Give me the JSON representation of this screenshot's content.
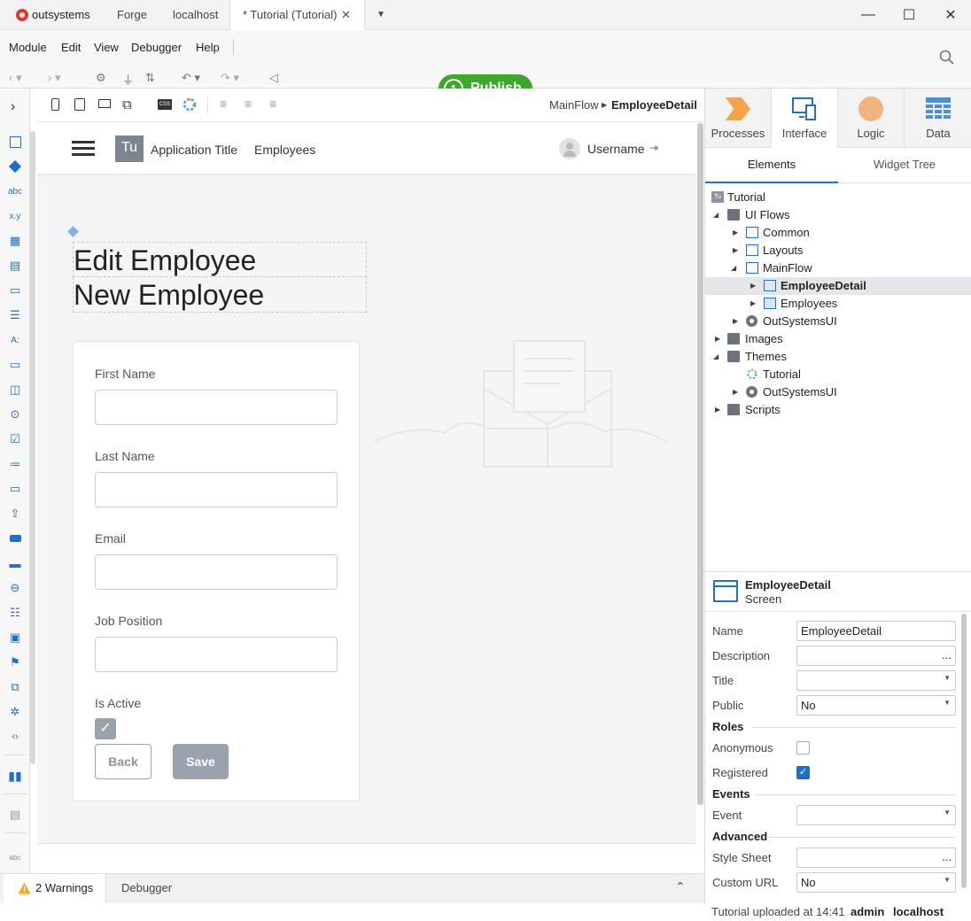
{
  "titlebar": {
    "brand": "outsystems",
    "tabs": [
      "Forge",
      "localhost",
      "* Tutorial (Tutorial)"
    ],
    "minimize": "—",
    "maximize": "☐",
    "close": "✕"
  },
  "menu": {
    "items": [
      "Module",
      "Edit",
      "View",
      "Debugger",
      "Help"
    ],
    "publish_count": "1",
    "publish_label": "Publish"
  },
  "breadcrumb": {
    "parent": "MainFlow",
    "current": "EmployeeDetail"
  },
  "canvas": {
    "logo": "Tu",
    "app_title": "Application Title",
    "menu_link": "Employees",
    "username": "Username",
    "title_edit": "Edit Employee",
    "title_new": "New Employee",
    "fields": [
      "First Name",
      "Last Name",
      "Email",
      "Job Position",
      "Is Active"
    ],
    "is_active_checked": true,
    "back_label": "Back",
    "save_label": "Save"
  },
  "bottom": {
    "warnings": "2 Warnings",
    "debugger": "Debugger"
  },
  "right_tabs": [
    "Processes",
    "Interface",
    "Logic",
    "Data"
  ],
  "subtabs": {
    "elements": "Elements",
    "widget_tree": "Widget Tree"
  },
  "tree": {
    "root": "Tutorial",
    "ui_flows": "UI Flows",
    "common": "Common",
    "layouts": "Layouts",
    "mainflow": "MainFlow",
    "employee_detail": "EmployeeDetail",
    "employees": "Employees",
    "outsystemsui": "OutSystemsUI",
    "images": "Images",
    "themes": "Themes",
    "theme_tutorial": "Tutorial",
    "theme_outsystemsui": "OutSystemsUI",
    "scripts": "Scripts"
  },
  "properties": {
    "element_name": "EmployeeDetail",
    "element_type": "Screen",
    "name_label": "Name",
    "name_value": "EmployeeDetail",
    "description_label": "Description",
    "description_btn": "...",
    "title_label": "Title",
    "public_label": "Public",
    "public_value": "No",
    "roles_section": "Roles",
    "anonymous_label": "Anonymous",
    "anonymous_checked": false,
    "registered_label": "Registered",
    "registered_checked": true,
    "events_section": "Events",
    "event_label": "Event",
    "advanced_section": "Advanced",
    "stylesheet_label": "Style Sheet",
    "stylesheet_btn": "...",
    "customurl_label": "Custom URL",
    "customurl_value": "No"
  },
  "status": {
    "message": "Tutorial uploaded at 14:41",
    "user": "admin",
    "server": "localhost"
  },
  "colors": {
    "accent": "#1f6fc9",
    "publish": "#3fa72b",
    "processes": "#f6a348",
    "logic": "#f3b37e",
    "data": "#4a90d9",
    "save_button": "#9aa2ad"
  }
}
